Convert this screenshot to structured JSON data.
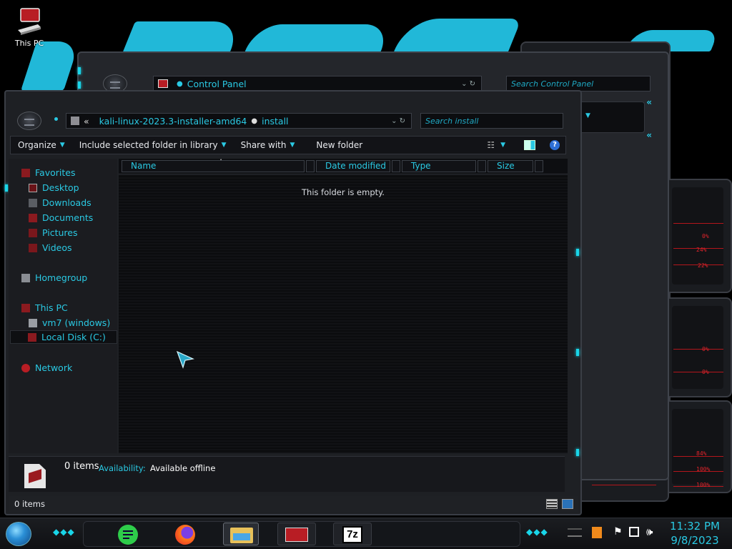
{
  "desktop": {
    "icon_label": "This PC"
  },
  "back_window": {
    "address": "Control Panel",
    "search_placeholder": "Search Control Panel"
  },
  "window": {
    "address_overflow": "«",
    "address_segments": [
      "kali-linux-2023.3-installer-amd64",
      "install"
    ],
    "search_placeholder": "Search install",
    "toolbar": {
      "organize": "Organize",
      "include_library": "Include selected folder in library",
      "share_with": "Share with",
      "new_folder": "New folder"
    },
    "nav": {
      "favorites": "Favorites",
      "desktop": "Desktop",
      "downloads": "Downloads",
      "documents": "Documents",
      "pictures": "Pictures",
      "videos": "Videos",
      "homegroup": "Homegroup",
      "this_pc": "This PC",
      "vm7": "vm7 (windows)",
      "local_disk": "Local Disk (C:)",
      "network": "Network"
    },
    "columns": {
      "name": "Name",
      "date_modified": "Date modified",
      "type": "Type",
      "size": "Size"
    },
    "empty_message": "This folder is empty.",
    "details": {
      "count": "0 items",
      "availability_label": "Availability:",
      "availability_value": "Available offline"
    },
    "status_count": "0 items"
  },
  "hud_readouts": [
    "0%",
    "24%",
    "22%",
    "0%",
    "0%",
    "84%",
    "100%",
    "100%"
  ],
  "taskbar": {
    "apps": [
      "notes-app",
      "firefox",
      "file-explorer",
      "media-app",
      "7zip"
    ],
    "sevenzip_label": "7z",
    "time": "11:32 PM",
    "date": "9/8/2023"
  },
  "colors": {
    "accent": "#2ac9e3",
    "wallpaper": "#21b8d8",
    "hud_red": "#e3242b"
  }
}
